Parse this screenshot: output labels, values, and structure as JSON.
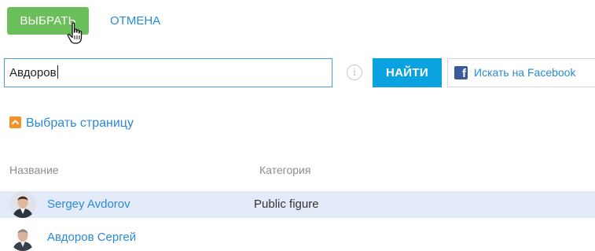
{
  "toolbar": {
    "select_label": "ВЫБРАТЬ",
    "cancel_label": "ОТМЕНА"
  },
  "search": {
    "value": "Авдоров",
    "find_label": "НАЙТИ",
    "facebook_label": "Искать на Facebook",
    "info_glyph": "i",
    "facebook_glyph": "f"
  },
  "choose_page": {
    "label": "Выбрать страницу"
  },
  "table": {
    "columns": [
      "Название",
      "Категория"
    ],
    "rows": [
      {
        "name": "Sergey Avdorov",
        "category": "Public figure",
        "selected": true
      },
      {
        "name": "Авдоров Сергей",
        "category": "",
        "selected": false
      }
    ]
  },
  "colors": {
    "select_button": "#6bbf5a",
    "find_button": "#0aa2df",
    "link": "#2a8ad4",
    "accent_orange": "#f39325",
    "row_highlight": "#e3ebfa",
    "facebook_blue": "#3b5a9a"
  },
  "icons": {
    "cursor": "hand-pointer-icon",
    "info": "info-icon",
    "facebook": "facebook-icon",
    "choose_page": "chevron-up-icon"
  }
}
